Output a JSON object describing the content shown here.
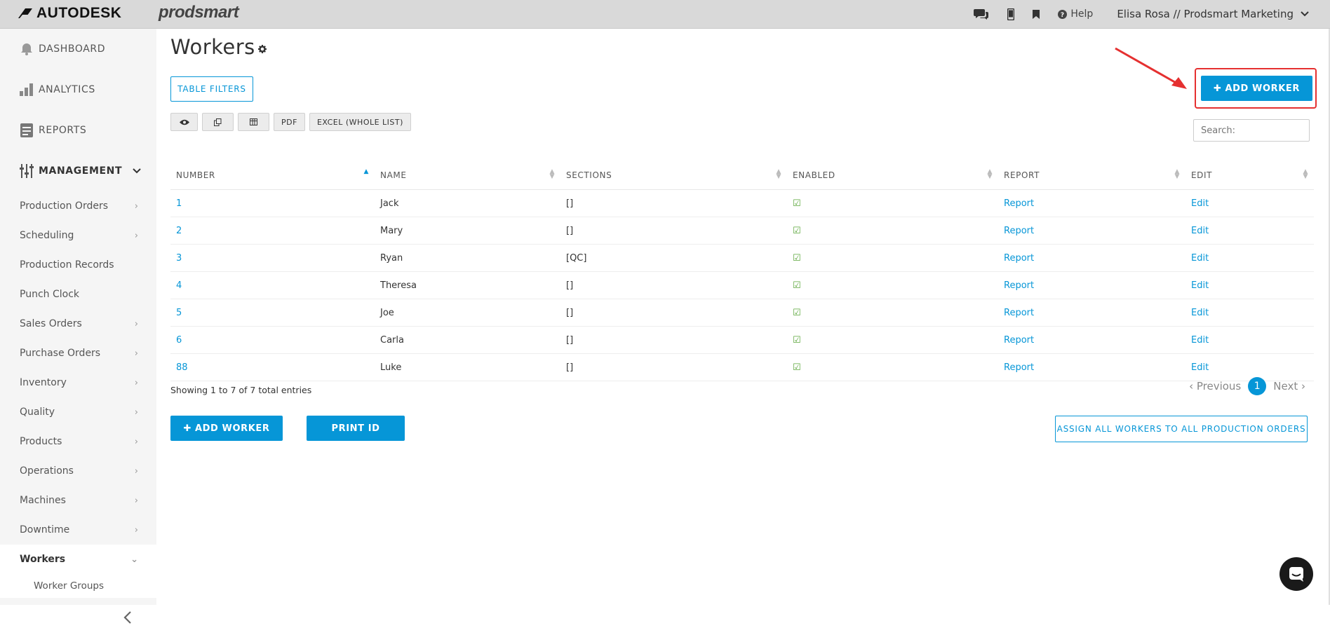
{
  "topbar": {
    "brand": "AUTODESK",
    "product": "prodsmart",
    "help_label": "Help",
    "user_label": "Elisa Rosa // Prodsmart Marketing"
  },
  "sidebar": {
    "dashboard": "DASHBOARD",
    "analytics": "ANALYTICS",
    "reports": "REPORTS",
    "management": "MANAGEMENT",
    "items": [
      {
        "label": "Production Orders"
      },
      {
        "label": "Scheduling"
      },
      {
        "label": "Production Records"
      },
      {
        "label": "Punch Clock"
      },
      {
        "label": "Sales Orders"
      },
      {
        "label": "Purchase Orders"
      },
      {
        "label": "Inventory"
      },
      {
        "label": "Quality"
      },
      {
        "label": "Products"
      },
      {
        "label": "Operations"
      },
      {
        "label": "Machines"
      },
      {
        "label": "Downtime"
      },
      {
        "label": "Workers"
      }
    ],
    "sub_items": [
      {
        "label": "Worker Groups"
      }
    ]
  },
  "page": {
    "title": "Workers",
    "table_filters_label": "TABLE FILTERS",
    "add_worker_label": "ADD WORKER",
    "print_id_label": "PRINT ID",
    "assign_all_label": "ASSIGN ALL WORKERS TO ALL PRODUCTION ORDERS",
    "search_placeholder": "Search:",
    "tools": {
      "pdf": "PDF",
      "excel": "EXCEL (WHOLE LIST)"
    }
  },
  "table": {
    "headers": {
      "number": "NUMBER",
      "name": "NAME",
      "sections": "SECTIONS",
      "enabled": "ENABLED",
      "report": "REPORT",
      "edit": "EDIT"
    },
    "rows": [
      {
        "number": "1",
        "name": "Jack",
        "sections": "[]",
        "report": "Report",
        "edit": "Edit"
      },
      {
        "number": "2",
        "name": "Mary",
        "sections": "[]",
        "report": "Report",
        "edit": "Edit"
      },
      {
        "number": "3",
        "name": "Ryan",
        "sections": "[QC]",
        "report": "Report",
        "edit": "Edit"
      },
      {
        "number": "4",
        "name": "Theresa",
        "sections": "[]",
        "report": "Report",
        "edit": "Edit"
      },
      {
        "number": "5",
        "name": "Joe",
        "sections": "[]",
        "report": "Report",
        "edit": "Edit"
      },
      {
        "number": "6",
        "name": "Carla",
        "sections": "[]",
        "report": "Report",
        "edit": "Edit"
      },
      {
        "number": "88",
        "name": "Luke",
        "sections": "[]",
        "report": "Report",
        "edit": "Edit"
      }
    ]
  },
  "footer": {
    "showing": "Showing 1 to 7 of 7 total entries",
    "previous": "Previous",
    "current_page": "1",
    "next": "Next"
  },
  "colors": {
    "accent": "#0696d7",
    "annotation": "#e53030",
    "check": "#5aa63a"
  }
}
